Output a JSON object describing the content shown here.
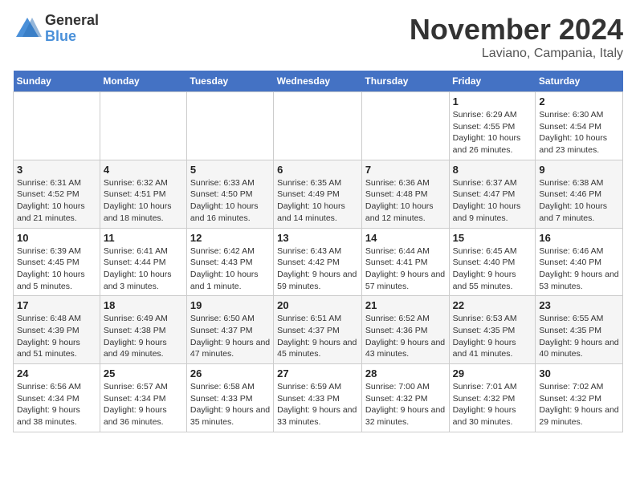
{
  "logo": {
    "general": "General",
    "blue": "Blue"
  },
  "title": "November 2024",
  "location": "Laviano, Campania, Italy",
  "headers": [
    "Sunday",
    "Monday",
    "Tuesday",
    "Wednesday",
    "Thursday",
    "Friday",
    "Saturday"
  ],
  "weeks": [
    [
      {
        "day": "",
        "info": ""
      },
      {
        "day": "",
        "info": ""
      },
      {
        "day": "",
        "info": ""
      },
      {
        "day": "",
        "info": ""
      },
      {
        "day": "",
        "info": ""
      },
      {
        "day": "1",
        "info": "Sunrise: 6:29 AM\nSunset: 4:55 PM\nDaylight: 10 hours and 26 minutes."
      },
      {
        "day": "2",
        "info": "Sunrise: 6:30 AM\nSunset: 4:54 PM\nDaylight: 10 hours and 23 minutes."
      }
    ],
    [
      {
        "day": "3",
        "info": "Sunrise: 6:31 AM\nSunset: 4:52 PM\nDaylight: 10 hours and 21 minutes."
      },
      {
        "day": "4",
        "info": "Sunrise: 6:32 AM\nSunset: 4:51 PM\nDaylight: 10 hours and 18 minutes."
      },
      {
        "day": "5",
        "info": "Sunrise: 6:33 AM\nSunset: 4:50 PM\nDaylight: 10 hours and 16 minutes."
      },
      {
        "day": "6",
        "info": "Sunrise: 6:35 AM\nSunset: 4:49 PM\nDaylight: 10 hours and 14 minutes."
      },
      {
        "day": "7",
        "info": "Sunrise: 6:36 AM\nSunset: 4:48 PM\nDaylight: 10 hours and 12 minutes."
      },
      {
        "day": "8",
        "info": "Sunrise: 6:37 AM\nSunset: 4:47 PM\nDaylight: 10 hours and 9 minutes."
      },
      {
        "day": "9",
        "info": "Sunrise: 6:38 AM\nSunset: 4:46 PM\nDaylight: 10 hours and 7 minutes."
      }
    ],
    [
      {
        "day": "10",
        "info": "Sunrise: 6:39 AM\nSunset: 4:45 PM\nDaylight: 10 hours and 5 minutes."
      },
      {
        "day": "11",
        "info": "Sunrise: 6:41 AM\nSunset: 4:44 PM\nDaylight: 10 hours and 3 minutes."
      },
      {
        "day": "12",
        "info": "Sunrise: 6:42 AM\nSunset: 4:43 PM\nDaylight: 10 hours and 1 minute."
      },
      {
        "day": "13",
        "info": "Sunrise: 6:43 AM\nSunset: 4:42 PM\nDaylight: 9 hours and 59 minutes."
      },
      {
        "day": "14",
        "info": "Sunrise: 6:44 AM\nSunset: 4:41 PM\nDaylight: 9 hours and 57 minutes."
      },
      {
        "day": "15",
        "info": "Sunrise: 6:45 AM\nSunset: 4:40 PM\nDaylight: 9 hours and 55 minutes."
      },
      {
        "day": "16",
        "info": "Sunrise: 6:46 AM\nSunset: 4:40 PM\nDaylight: 9 hours and 53 minutes."
      }
    ],
    [
      {
        "day": "17",
        "info": "Sunrise: 6:48 AM\nSunset: 4:39 PM\nDaylight: 9 hours and 51 minutes."
      },
      {
        "day": "18",
        "info": "Sunrise: 6:49 AM\nSunset: 4:38 PM\nDaylight: 9 hours and 49 minutes."
      },
      {
        "day": "19",
        "info": "Sunrise: 6:50 AM\nSunset: 4:37 PM\nDaylight: 9 hours and 47 minutes."
      },
      {
        "day": "20",
        "info": "Sunrise: 6:51 AM\nSunset: 4:37 PM\nDaylight: 9 hours and 45 minutes."
      },
      {
        "day": "21",
        "info": "Sunrise: 6:52 AM\nSunset: 4:36 PM\nDaylight: 9 hours and 43 minutes."
      },
      {
        "day": "22",
        "info": "Sunrise: 6:53 AM\nSunset: 4:35 PM\nDaylight: 9 hours and 41 minutes."
      },
      {
        "day": "23",
        "info": "Sunrise: 6:55 AM\nSunset: 4:35 PM\nDaylight: 9 hours and 40 minutes."
      }
    ],
    [
      {
        "day": "24",
        "info": "Sunrise: 6:56 AM\nSunset: 4:34 PM\nDaylight: 9 hours and 38 minutes."
      },
      {
        "day": "25",
        "info": "Sunrise: 6:57 AM\nSunset: 4:34 PM\nDaylight: 9 hours and 36 minutes."
      },
      {
        "day": "26",
        "info": "Sunrise: 6:58 AM\nSunset: 4:33 PM\nDaylight: 9 hours and 35 minutes."
      },
      {
        "day": "27",
        "info": "Sunrise: 6:59 AM\nSunset: 4:33 PM\nDaylight: 9 hours and 33 minutes."
      },
      {
        "day": "28",
        "info": "Sunrise: 7:00 AM\nSunset: 4:32 PM\nDaylight: 9 hours and 32 minutes."
      },
      {
        "day": "29",
        "info": "Sunrise: 7:01 AM\nSunset: 4:32 PM\nDaylight: 9 hours and 30 minutes."
      },
      {
        "day": "30",
        "info": "Sunrise: 7:02 AM\nSunset: 4:32 PM\nDaylight: 9 hours and 29 minutes."
      }
    ]
  ]
}
